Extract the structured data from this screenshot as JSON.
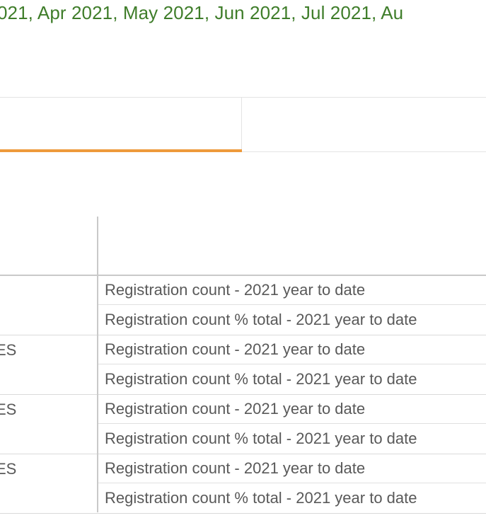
{
  "filter_summary": "021, Apr 2021, May 2021, Jun 2021, Jul 2021, Au",
  "tabs": [
    {
      "label": "",
      "active": true
    },
    {
      "label": "",
      "active": false
    }
  ],
  "colors": {
    "filter_text": "#3f7d2a",
    "tab_active_underline": "#ee9a3b",
    "cell_text": "#595959"
  },
  "table": {
    "rows": [
      {
        "group_label": "",
        "measures": [
          "Registration count - 2021 year to date",
          "Registration count % total - 2021 year to date"
        ]
      },
      {
        "group_label": "ES",
        "measures": [
          "Registration count - 2021 year to date",
          "Registration count % total - 2021 year to date"
        ]
      },
      {
        "group_label": "ES",
        "measures": [
          "Registration count - 2021 year to date",
          "Registration count % total - 2021 year to date"
        ]
      },
      {
        "group_label": "ES",
        "measures": [
          "Registration count - 2021 year to date",
          "Registration count % total - 2021 year to date"
        ]
      }
    ]
  }
}
